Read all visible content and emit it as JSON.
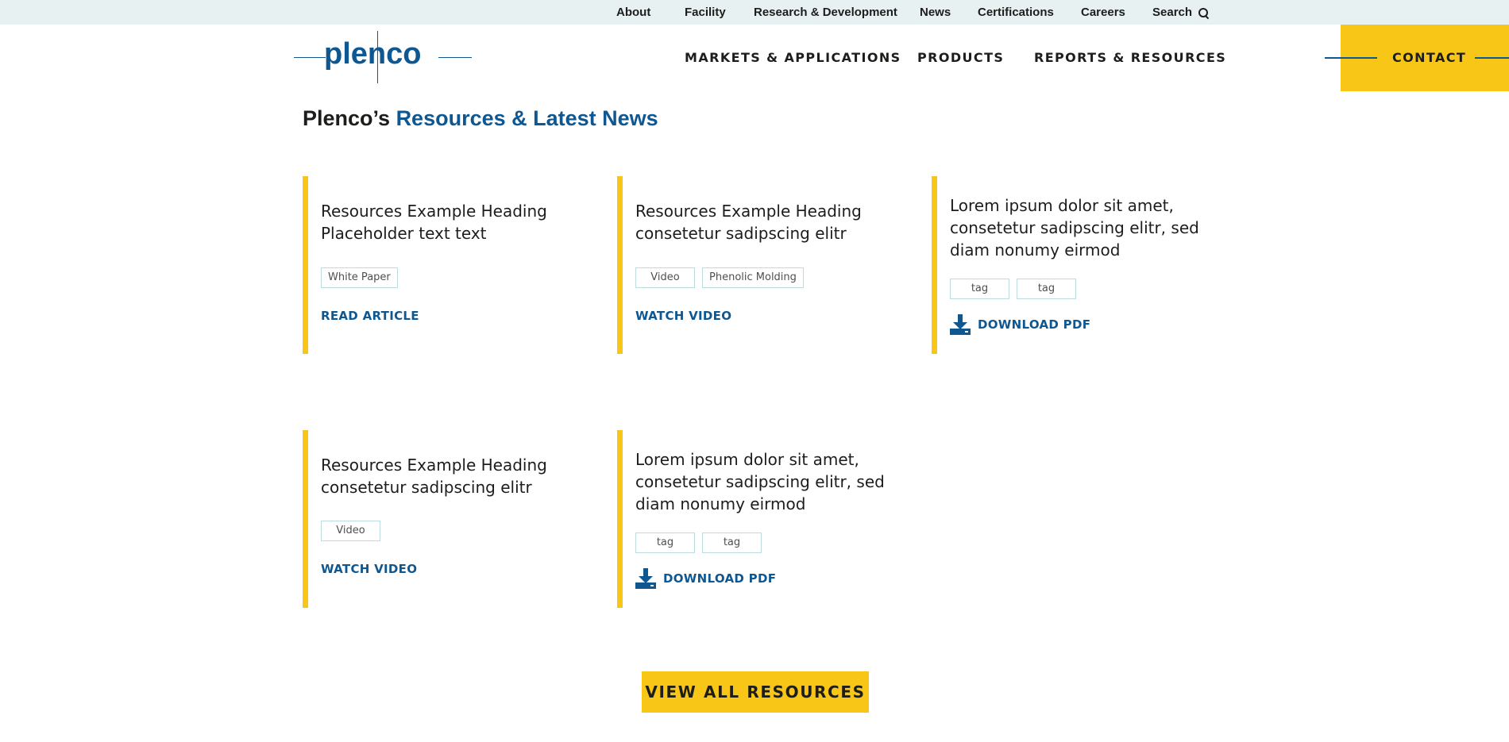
{
  "utility_nav": [
    {
      "label": "About"
    },
    {
      "label": "Facility"
    },
    {
      "label": "Research & Development"
    },
    {
      "label": "News"
    },
    {
      "label": "Certifications"
    },
    {
      "label": "Careers"
    },
    {
      "label": "Search"
    }
  ],
  "logo": {
    "text": "plenco"
  },
  "main_nav": [
    {
      "label": "MARKETS & APPLICATIONS"
    },
    {
      "label": "PRODUCTS"
    },
    {
      "label": "REPORTS & RESOURCES"
    }
  ],
  "contact": {
    "label": "CONTACT"
  },
  "section": {
    "title_prefix": "Plenco’s",
    "title_accent": "Resources & Latest News"
  },
  "cards": [
    {
      "heading": "Resources Example Heading Placeholder text text",
      "tags": [
        "White Paper"
      ],
      "action": "READ ARTICLE",
      "icon": ""
    },
    {
      "heading": "Resources Example Heading consetetur sadipscing elitr",
      "tags": [
        "Video",
        "Phenolic Molding"
      ],
      "action": "WATCH VIDEO",
      "icon": ""
    },
    {
      "heading": "Lorem ipsum dolor sit amet, consetetur sadipscing elitr, sed diam nonumy eirmod",
      "tags": [
        "tag",
        "tag"
      ],
      "action": "DOWNLOAD PDF",
      "icon": "download-icon"
    },
    {
      "heading": "Resources Example Heading consetetur sadipscing elitr",
      "tags": [
        "Video"
      ],
      "action": "WATCH VIDEO",
      "icon": ""
    },
    {
      "heading": "Lorem ipsum dolor sit amet, consetetur sadipscing elitr, sed diam nonumy eirmod",
      "tags": [
        "tag",
        "tag"
      ],
      "action": "DOWNLOAD PDF",
      "icon": "download-icon"
    }
  ],
  "view_all": {
    "label": "VIEW ALL RESOURCES"
  },
  "colors": {
    "brand_blue": "#0e5791",
    "accent_yellow": "#f8c617",
    "utility_bg": "#e8f1f2",
    "tag_border": "#bcdcdf"
  }
}
